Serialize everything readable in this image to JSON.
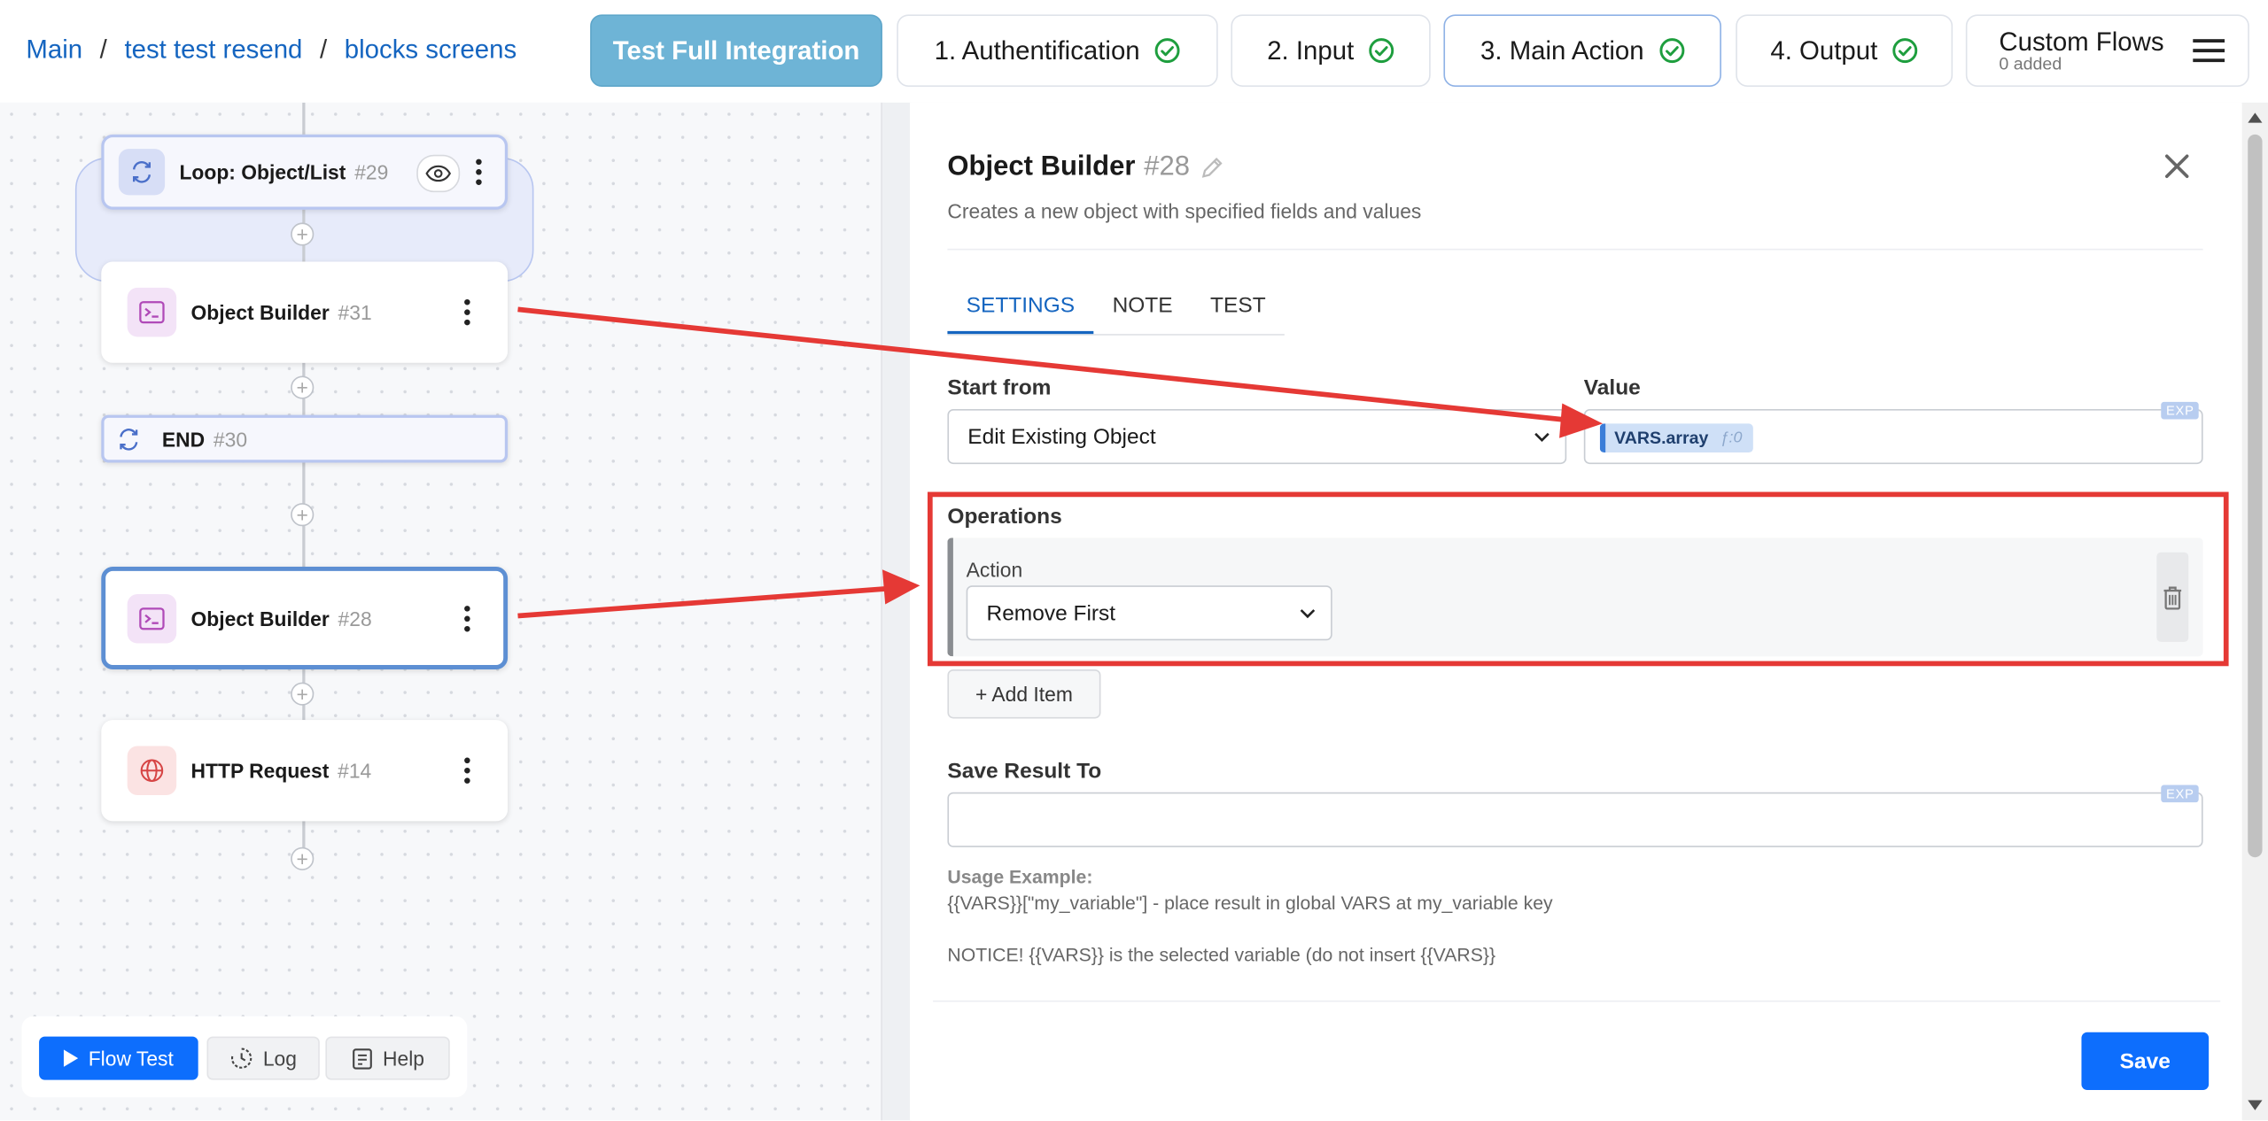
{
  "breadcrumb": [
    "Main",
    "test test resend",
    "blocks screens"
  ],
  "header": {
    "test_full": "Test Full Integration",
    "steps": [
      "1. Authentification",
      "2. Input",
      "3. Main Action",
      "4. Output"
    ],
    "custom_flows": "Custom Flows",
    "custom_flows_sub": "0 added"
  },
  "flow": {
    "loop": {
      "name": "Loop: Object/List",
      "num": "#29"
    },
    "node31": {
      "name": "Object Builder",
      "num": "#31"
    },
    "end": {
      "name": "END",
      "num": "#30"
    },
    "node28": {
      "name": "Object Builder",
      "num": "#28"
    },
    "node14": {
      "name": "HTTP Request",
      "num": "#14"
    }
  },
  "toolbar": {
    "flow_test": "Flow Test",
    "log": "Log",
    "help": "Help"
  },
  "panel": {
    "title": "Object Builder",
    "title_num": "#28",
    "description": "Creates a new object with specified fields and values",
    "tabs": [
      "SETTINGS",
      "NOTE",
      "TEST"
    ],
    "start_from_label": "Start from",
    "start_from_value": "Edit Existing Object",
    "value_label": "Value",
    "exp_badge": "EXP",
    "chip_var": "VARS.array",
    "chip_index": "ƒ:0",
    "operations_label": "Operations",
    "action_label": "Action",
    "action_value": "Remove First",
    "add_item": "+ Add Item",
    "save_result_label": "Save Result To",
    "usage_title": "Usage Example:",
    "usage_line": "{{VARS}}[\"my_variable\"] - place result in global VARS at my_variable key",
    "notice": "NOTICE! {{VARS}} is the selected variable (do not insert {{VARS}}",
    "save": "Save"
  },
  "colors": {
    "primary": "#0d6efd",
    "accent": "#6eb4d6",
    "annotation": "#e53935"
  }
}
